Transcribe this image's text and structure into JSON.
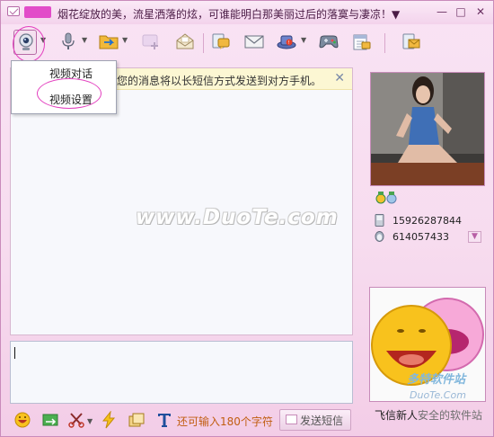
{
  "window": {
    "title": "烟花绽放的美，流星洒落的炫，可谁能明白那美丽过后的落寞与凄凉！",
    "title_suffix": "▼",
    "controls": {
      "minimize": "—",
      "maximize": "□",
      "close": "✕"
    }
  },
  "toolbar": {
    "items": [
      {
        "name": "video-icon"
      },
      {
        "name": "microphone-icon"
      },
      {
        "name": "file-transfer-icon"
      },
      {
        "name": "add-contact-icon"
      },
      {
        "name": "envelope-open-icon"
      },
      {
        "name": "chat-bubble-icon"
      },
      {
        "name": "mail-icon"
      },
      {
        "name": "hat-icon"
      },
      {
        "name": "gamepad-icon"
      },
      {
        "name": "calendar-icon"
      },
      {
        "name": "sms-mail-icon"
      }
    ]
  },
  "video_menu": {
    "items": [
      "视频对话",
      "视频设置"
    ]
  },
  "notice": {
    "text": "您的消息将以长短信方式发送到对方手机。",
    "close": "✕"
  },
  "watermark": "www.DuoTe.com",
  "bottom_bar": {
    "char_hint": "还可输入180个字符",
    "send_label": "发送短信"
  },
  "contact": {
    "phone": "15926287844",
    "qq": "614057433",
    "avatar_label": "飞信新人",
    "expand": "▼"
  },
  "site_watermark": {
    "line1": "多特软件站",
    "line2": "DuoTe.Com",
    "line3": "安全的软件站"
  },
  "colors": {
    "title_bg": "#f3d3ec",
    "notice_bg": "#fcf7d3",
    "hint_text": "#c15e11",
    "highlight_ring": "#e33fbf"
  }
}
